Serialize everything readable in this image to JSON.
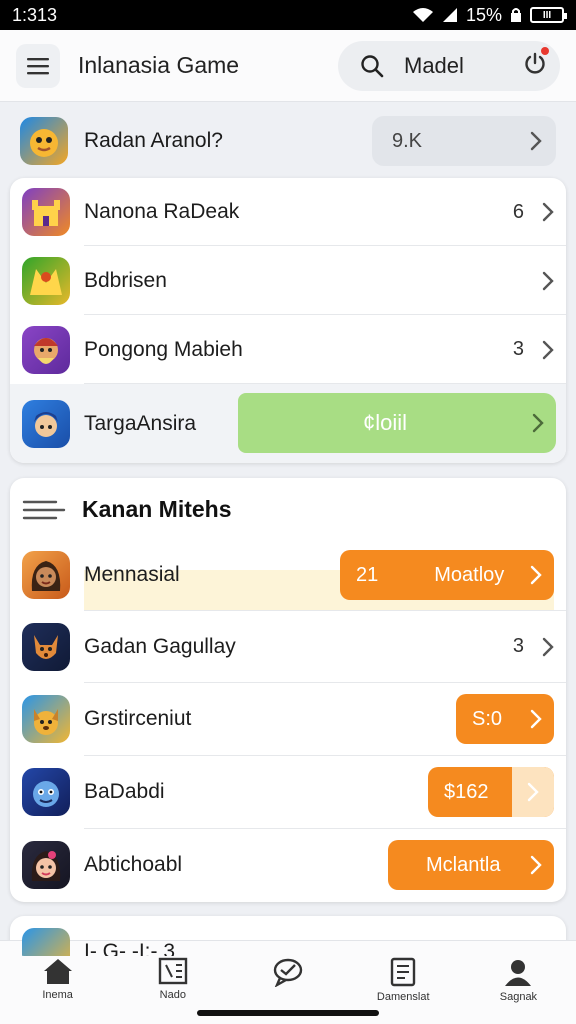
{
  "status_bar": {
    "time": "1:313",
    "battery_pct": "15%",
    "battery_label": "III"
  },
  "header": {
    "title": "Inlanasia Game",
    "search_text": "Madel"
  },
  "featured": {
    "name": "Radan Aranol?",
    "count": "9.K"
  },
  "list1": [
    {
      "name": "Nanona RaDeak",
      "value": "6",
      "icon": "game-icon-castle",
      "color": "#6a3aa8"
    },
    {
      "name": "Bdbrisen",
      "value": "",
      "icon": "game-icon-arena",
      "color": "#3e9b2d"
    },
    {
      "name": "Pongong Mabieh",
      "value": "3",
      "icon": "game-icon-dwarf",
      "color": "#7a3fb0"
    },
    {
      "name": "TargaAnsira",
      "value": "",
      "icon": "game-icon-warrior",
      "color": "#2b6fd4",
      "highlight_label": "¢loiil"
    }
  ],
  "section": {
    "title": "Kanan Mitehs"
  },
  "list2": [
    {
      "name": "Mennasial",
      "button": {
        "left": "21",
        "right": "Moatloy"
      },
      "icon": "game-icon-girl",
      "color": "#e07a2a"
    },
    {
      "name": "Gadan Gagullay",
      "value": "3",
      "icon": "game-icon-fox",
      "color": "#1e2c54"
    },
    {
      "name": "Grstirceniut",
      "button": {
        "left": "S:0"
      },
      "icon": "game-icon-dog",
      "color": "#1a7fd6"
    },
    {
      "name": "BaDabdi",
      "button": {
        "left": "$162"
      },
      "icon": "game-icon-monster",
      "color": "#1c3c8c"
    },
    {
      "name": "Abtichoabl",
      "button": {
        "left": "Mclantla"
      },
      "icon": "game-icon-princess",
      "color": "#1c1c2e"
    }
  ],
  "partial_row": {
    "name": "I- G- -I:- 3"
  },
  "nav": [
    {
      "label": "Inema",
      "icon": "home-icon"
    },
    {
      "label": "Nado",
      "icon": "news-icon"
    },
    {
      "label": "",
      "icon": "chat-icon"
    },
    {
      "label": "Damenslat",
      "icon": "document-icon"
    },
    {
      "label": "Sagnak",
      "icon": "profile-icon"
    }
  ],
  "colors": {
    "accent_orange": "#f58a1f",
    "highlight_green": "#a8dd84",
    "cream": "#fdf4d8"
  }
}
